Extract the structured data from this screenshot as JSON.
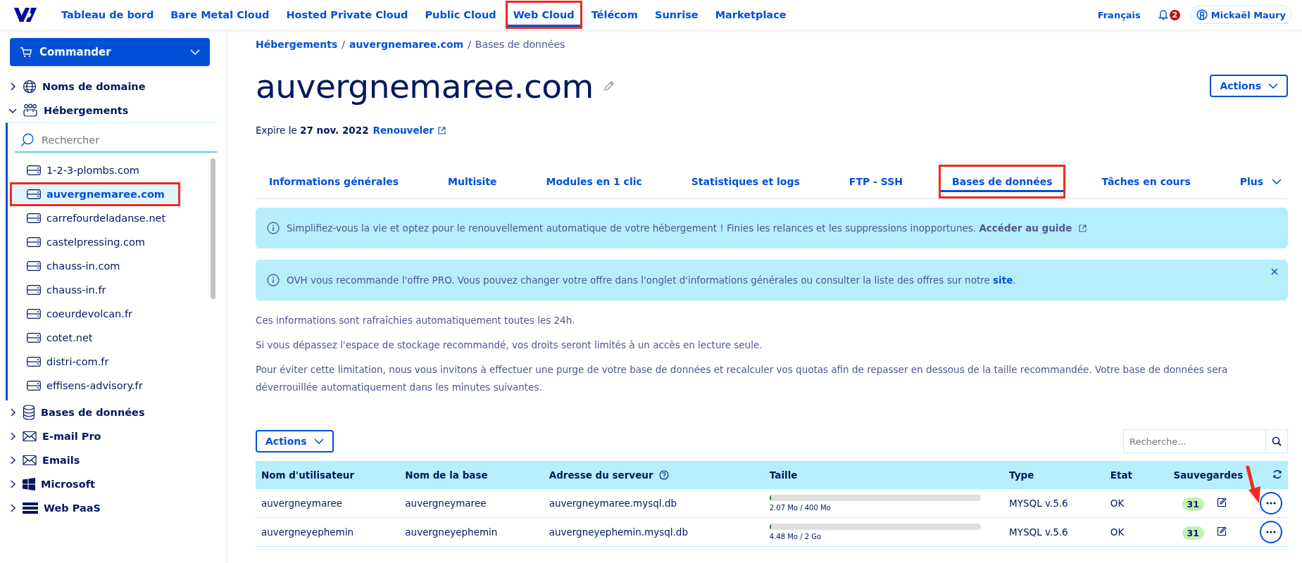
{
  "topbar": {
    "nav": [
      {
        "label": "Tableau de bord",
        "selected": false,
        "annotated": false
      },
      {
        "label": "Bare Metal Cloud",
        "selected": false,
        "annotated": false
      },
      {
        "label": "Hosted Private Cloud",
        "selected": false,
        "annotated": false
      },
      {
        "label": "Public Cloud",
        "selected": false,
        "annotated": false
      },
      {
        "label": "Web Cloud",
        "selected": true,
        "annotated": true
      },
      {
        "label": "Télécom",
        "selected": false,
        "annotated": false
      },
      {
        "label": "Sunrise",
        "selected": false,
        "annotated": false
      },
      {
        "label": "Marketplace",
        "selected": false,
        "annotated": false
      }
    ],
    "language": "Français",
    "notifications": "2",
    "user": "Mickaël Maury"
  },
  "sidebar": {
    "order_button": "Commander",
    "sections_before": [
      {
        "label": "Noms de domaine",
        "kind": "domains",
        "expanded": false
      },
      {
        "label": "Hébergements",
        "kind": "hosting",
        "expanded": true
      }
    ],
    "search": {
      "placeholder": "Rechercher"
    },
    "items": [
      {
        "label": "1-2-3-plombs.com",
        "selected": false,
        "annotated": false
      },
      {
        "label": "auvergnemaree.com",
        "selected": true,
        "annotated": true
      },
      {
        "label": "carrefourdeladanse.net",
        "selected": false,
        "annotated": false
      },
      {
        "label": "castelpressing.com",
        "selected": false,
        "annotated": false
      },
      {
        "label": "chauss-in.com",
        "selected": false,
        "annotated": false
      },
      {
        "label": "chauss-in.fr",
        "selected": false,
        "annotated": false
      },
      {
        "label": "coeurdevolcan.fr",
        "selected": false,
        "annotated": false
      },
      {
        "label": "cotet.net",
        "selected": false,
        "annotated": false
      },
      {
        "label": "distri-com.fr",
        "selected": false,
        "annotated": false
      },
      {
        "label": "effisens-advisory.fr",
        "selected": false,
        "annotated": false
      }
    ],
    "sections_after": [
      {
        "label": "Bases de données",
        "kind": "databases",
        "expanded": false
      },
      {
        "label": "E-mail Pro",
        "kind": "emailpro",
        "expanded": false
      },
      {
        "label": "Emails",
        "kind": "emails",
        "expanded": false
      },
      {
        "label": "Microsoft",
        "kind": "microsoft",
        "expanded": false
      },
      {
        "label": "Web PaaS",
        "kind": "paas",
        "expanded": false
      }
    ]
  },
  "breadcrumb": {
    "separator": "/",
    "items": [
      "Hébergements",
      "auvergnemaree.com",
      "Bases de données"
    ]
  },
  "title": "auvergnemaree.com",
  "actions_button": "Actions",
  "expiry": {
    "text": "Expire le **27 nov. 2022**",
    "link": "Renouveler"
  },
  "tabs": [
    {
      "label": "Informations générales",
      "selected": false,
      "annotated": false
    },
    {
      "label": "Multisite",
      "selected": false,
      "annotated": false
    },
    {
      "label": "Modules en 1 clic",
      "selected": false,
      "annotated": false
    },
    {
      "label": "Statistiques et logs",
      "selected": false,
      "annotated": false
    },
    {
      "label": "FTP - SSH",
      "selected": false,
      "annotated": false
    },
    {
      "label": "Bases de données",
      "selected": true,
      "annotated": true
    },
    {
      "label": "Tâches en cours",
      "selected": false,
      "annotated": false
    },
    {
      "label": "Plus",
      "selected": false,
      "annotated": false
    }
  ],
  "notices": [
    {
      "text": "Simplifiez-vous la vie et optez pour le renouvellement automatique de votre hébergement ! Finies les relances et les suppressions inopportunes.",
      "link": "Accéder au guide",
      "external": true,
      "closable": false
    },
    {
      "text": "OVH vous recommande l'offre PRO. Vous pouvez changer votre offre dans l'onglet d'informations générales ou consulter la liste des offres sur notre",
      "link": "site",
      "after": ".",
      "external": false,
      "closable": true
    }
  ],
  "paragraphs": [
    "Ces informations sont rafraîchies automatiquement toutes les 24h.",
    "Si vous dépassez l'espace de stockage recommandé, vos droits seront limités à un accès en lecture seule.",
    "Pour éviter cette limitation, nous vous invitons à effectuer une purge de votre base de données et recalculer vos quotas afin de repasser en dessous de la taille recommandée. Votre base de données sera déverrouillée automatiquement dans les minutes suivantes."
  ],
  "table": {
    "actions_button": "Actions",
    "search": {
      "placeholder": "Recherche..."
    },
    "columns": [
      "Nom d'utilisateur",
      "Nom de la base",
      "Adresse du serveur",
      "Taille",
      "Type",
      "Etat",
      "Sauvegardes"
    ],
    "rows": [
      {
        "user": "auvergneymaree",
        "base": "auvergneymaree",
        "server": "auvergneymaree.mysql.db",
        "level": 0.005,
        "size": "2.07 Mo / 400 Mo",
        "type": "MYSQL v.5.6",
        "state": "OK",
        "backups": "31"
      },
      {
        "user": "auvergneyephemin",
        "base": "auvergneyephemin",
        "server": "auvergneyephemin.mysql.db",
        "level": 0.0022,
        "size": "4.48 Mo / 2 Go",
        "type": "MYSQL v.5.6",
        "state": "OK",
        "backups": "31"
      }
    ]
  },
  "annotation_arrow": true
}
